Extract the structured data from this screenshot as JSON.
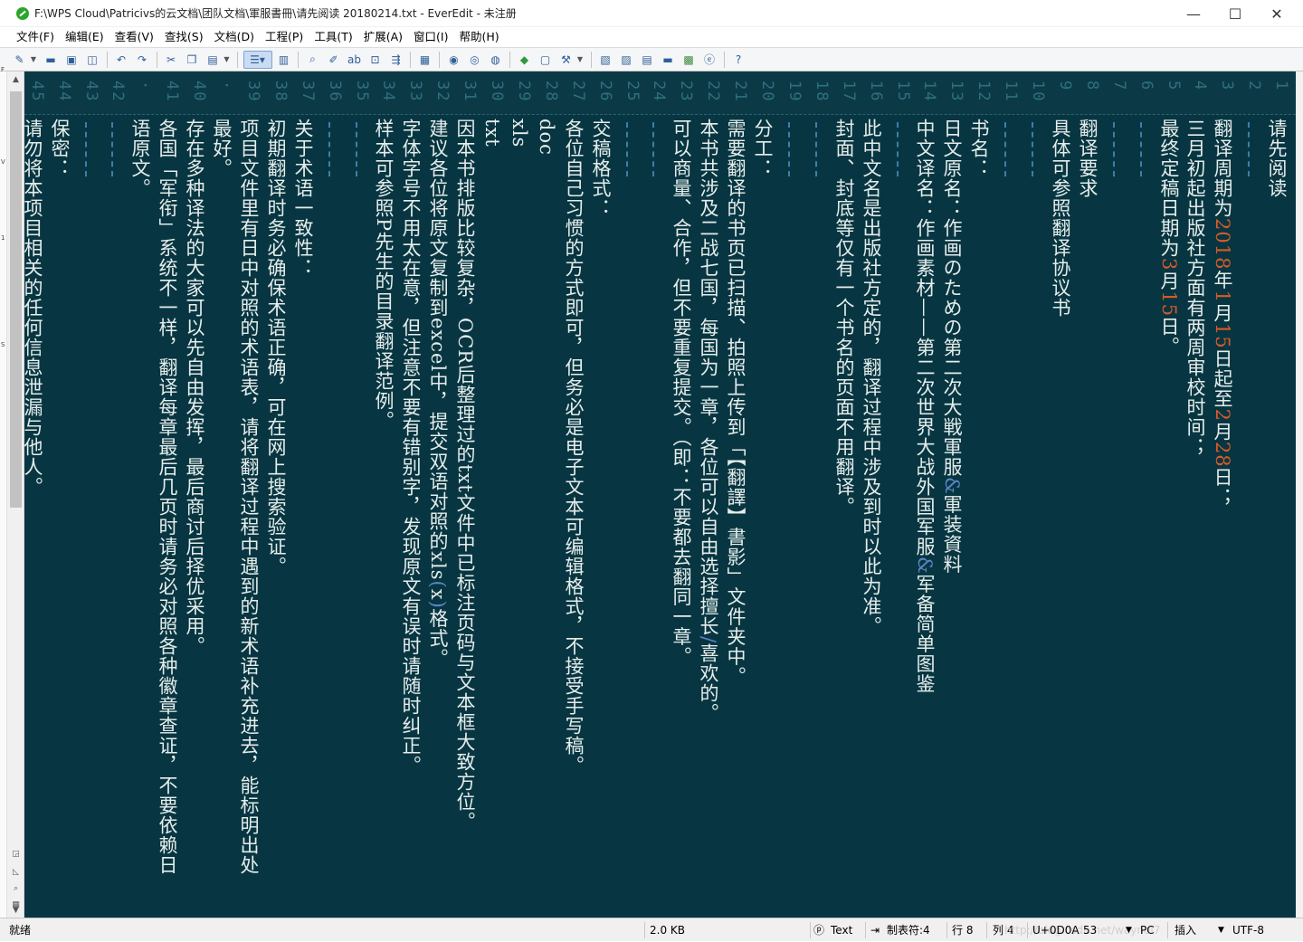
{
  "window": {
    "title": "F:\\WPS Cloud\\Patricivs的云文档\\团队文档\\軍服書冊\\请先阅读 20180214.txt - EverEdit - 未注册",
    "minimize": "—",
    "maximize": "☐",
    "close": "✕"
  },
  "menu": [
    "文件(F)",
    "编辑(E)",
    "查看(V)",
    "查找(S)",
    "文档(D)",
    "工程(P)",
    "工具(T)",
    "扩展(A)",
    "窗口(I)",
    "帮助(H)"
  ],
  "toolbar": {
    "icons": [
      "new-file-icon",
      "open-folder-icon",
      "save-icon",
      "save-all-icon",
      "undo-icon",
      "redo-icon",
      "cut-icon",
      "copy-icon",
      "paste-icon",
      "word-wrap-icon",
      "column-mode-icon",
      "find-icon",
      "find-replace-icon",
      "spell-check-icon",
      "find-in-files-icon",
      "goto-icon",
      "compare-icon",
      "macro-record-icon",
      "macro-play-icon",
      "macro-run-icon",
      "plugin-icon",
      "outline-icon",
      "tools-icon",
      "sidebar-icon",
      "panel-icon",
      "document-map-icon",
      "console-icon",
      "snippets-icon",
      "browser-icon",
      "help-icon"
    ]
  },
  "editor": {
    "background": "#073642",
    "columns": [
      {
        "line": "1",
        "text": "请先阅读"
      },
      {
        "line": "2",
        "text": ""
      },
      {
        "line": "3",
        "text": "翻译周期为2018年1月15日起至2月28日；"
      },
      {
        "line": "4",
        "text": "三月初起出版社方面有两周审校时间；"
      },
      {
        "line": "5",
        "text": "最终定稿日期为3月15日。"
      },
      {
        "line": "6",
        "text": ""
      },
      {
        "line": "7",
        "text": ""
      },
      {
        "line": "8",
        "text": "翻译要求"
      },
      {
        "line": "9",
        "text": "具体可参照翻译协议书"
      },
      {
        "line": "10",
        "text": ""
      },
      {
        "line": "11",
        "text": ""
      },
      {
        "line": "12",
        "text": "书名："
      },
      {
        "line": "13",
        "text": "日文原名：作画のための第二次大戦軍服&軍装資料"
      },
      {
        "line": "14",
        "text": "中文译名：作画素材——第二次世界大战外国军服&军备简单图鉴"
      },
      {
        "line": "15",
        "text": ""
      },
      {
        "line": "16",
        "text": "此中文名是出版社方定的，翻译过程中涉及到时以此为准。"
      },
      {
        "line": "17",
        "text": "封面、封底等仅有一个书名的页面不用翻译。"
      },
      {
        "line": "18",
        "text": ""
      },
      {
        "line": "19",
        "text": ""
      },
      {
        "line": "20",
        "text": "分工："
      },
      {
        "line": "21",
        "text": "需要翻译的书页已扫描、拍照上传到「【翻譯】書影」文件夹中。"
      },
      {
        "line": "22",
        "text": "本书共涉及二战七国，每国为一章，各位可以自由选择擅长/喜欢的。"
      },
      {
        "line": "23",
        "text": "可以商量、合作，但不要重复提交。（即：不要都去翻同一章。"
      },
      {
        "line": "24",
        "text": ""
      },
      {
        "line": "25",
        "text": ""
      },
      {
        "line": "26",
        "text": "交稿格式："
      },
      {
        "line": "27",
        "text": "各位自己习惯的方式即可，但务必是电子文本可编辑格式，不接受手写稿。"
      },
      {
        "line": "28",
        "text": "doc"
      },
      {
        "line": "29",
        "text": "xls"
      },
      {
        "line": "30",
        "text": "txt"
      },
      {
        "line": "31",
        "text": "因本书排版比较复杂，OCR后整理过的txt文件中已标注页码与文本框大致方位。"
      },
      {
        "line": "32",
        "text": "建议各位将原文复制到excel中，提交双语对照的xls(x)格式。"
      },
      {
        "line": "33",
        "text": "字体字号不用太在意，但注意不要有错别字，发现原文有误时请随时纠正。"
      },
      {
        "line": "34",
        "text": "样本可参照P先生的目录翻译范例。"
      },
      {
        "line": "35",
        "text": ""
      },
      {
        "line": "36",
        "text": ""
      },
      {
        "line": "37",
        "text": "关于术语一致性："
      },
      {
        "line": "38",
        "text": "初期翻译时务必确保术语正确，可在网上搜索验证。"
      },
      {
        "line": "39",
        "text": "项目文件里有日中对照的术语表，请将翻译过程中遇到的新术语补充进去，能标明出处"
      },
      {
        "line": "·",
        "text": "最好。"
      },
      {
        "line": "40",
        "text": "存在多种译法的大家可以先自由发挥，最后商讨后择优采用。"
      },
      {
        "line": "41",
        "text": "各国「军衔」系统不一样，翻译每章最后几页时请务必对照各种徽章查证，不要依赖日"
      },
      {
        "line": "·",
        "text": "语原文。"
      },
      {
        "line": "42",
        "text": ""
      },
      {
        "line": "43",
        "text": ""
      },
      {
        "line": "44",
        "text": "保密："
      },
      {
        "line": "45",
        "text": "请勿将本项目相关的任何信息泄漏与他人。"
      }
    ]
  },
  "status": {
    "ready": "就绪",
    "size": "2.0 KB",
    "mode": "Text",
    "tab": "制表符:4",
    "row": "行 8",
    "col": "列 4",
    "char_code": "U+0D0A",
    "char_dec": "53",
    "eol": "PC",
    "insert": "插入",
    "encoding": "UTF-8",
    "watermark": "http://blog.csdn.net/waynel7"
  }
}
